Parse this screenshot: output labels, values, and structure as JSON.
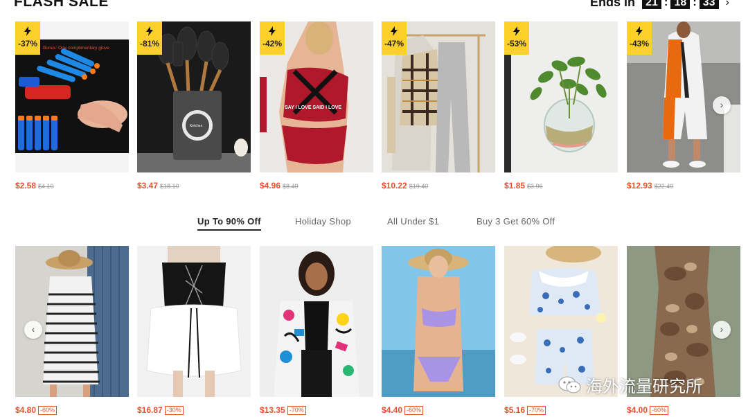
{
  "flash_sale": {
    "title": "FLASH SALE",
    "ends_label": "Ends in",
    "timer": [
      "21",
      "18",
      "33"
    ],
    "colon": ":",
    "more_arrow": "›",
    "colors": {
      "badge": "#fed12a",
      "price": "#e8502f"
    },
    "products": [
      {
        "discount": "-37%",
        "price": "$2.58",
        "original": "$4.10",
        "image_text": "Bonus: One complimentary glove"
      },
      {
        "discount": "-81%",
        "price": "$3.47",
        "original": "$18.10"
      },
      {
        "discount": "-42%",
        "price": "$4.96",
        "original": "$8.49",
        "image_text": "SAY I LOVE SAID I LOVE"
      },
      {
        "discount": "-47%",
        "price": "$10.22",
        "original": "$19.40"
      },
      {
        "discount": "-53%",
        "price": "$1.85",
        "original": "$3.96"
      },
      {
        "discount": "-43%",
        "price": "$12.93",
        "original": "$22.49"
      }
    ]
  },
  "tabs": [
    {
      "label": "Up To 90% Off",
      "active": true
    },
    {
      "label": "Holiday Shop",
      "active": false
    },
    {
      "label": "All Under $1",
      "active": false
    },
    {
      "label": "Buy 3 Get 60% Off",
      "active": false
    }
  ],
  "deals": {
    "products": [
      {
        "price": "$4.80",
        "off": "-60%"
      },
      {
        "price": "$16.87",
        "off": "-30%"
      },
      {
        "price": "$13.35",
        "off": "-70%"
      },
      {
        "price": "$4.40",
        "off": "-60%"
      },
      {
        "price": "$5.16",
        "off": "-70%"
      },
      {
        "price": "$4.00",
        "off": "-60%"
      }
    ]
  },
  "carousel": {
    "prev_icon": "‹",
    "next_icon": "›"
  },
  "watermark": {
    "text": "海外流量研究所"
  }
}
